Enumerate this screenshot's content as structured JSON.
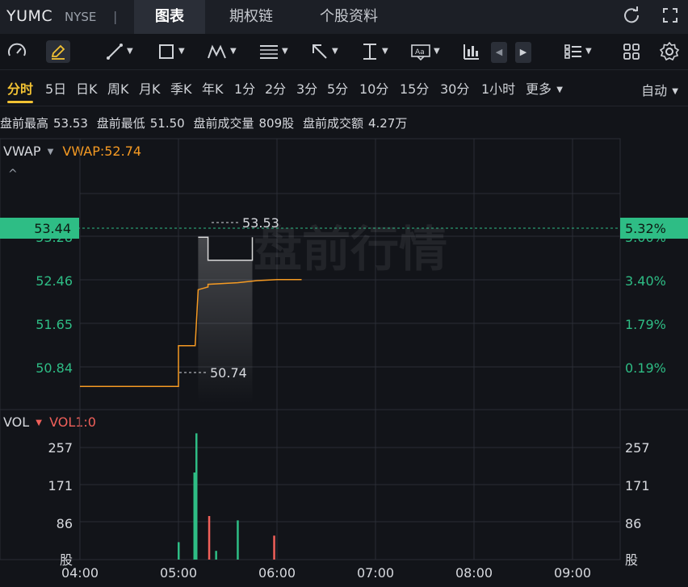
{
  "header": {
    "ticker": "YUMC",
    "exchange": "NYSE",
    "separator": "|",
    "tabs": [
      {
        "label": "图表",
        "active": true
      },
      {
        "label": "期权链",
        "active": false
      },
      {
        "label": "个股资料",
        "active": false
      }
    ]
  },
  "toolbar": {
    "icons": [
      "speedometer-icon",
      "pencil-icon",
      "line-tool-icon",
      "rectangle-tool-icon",
      "pattern-tool-icon",
      "fib-tool-icon",
      "arrow-tool-icon",
      "measure-tool-icon",
      "text-tool-icon",
      "indicator-icon",
      "prev-icon",
      "next-icon",
      "layout-list-icon",
      "grid-icon",
      "settings-icon"
    ]
  },
  "periods": {
    "items": [
      "分时",
      "5日",
      "日K",
      "周K",
      "月K",
      "季K",
      "年K",
      "1分",
      "2分",
      "3分",
      "5分",
      "10分",
      "15分",
      "30分",
      "1小时",
      "更多"
    ],
    "active_index": 0,
    "auto_label": "自动"
  },
  "info": {
    "high_label": "盘前最高",
    "high_value": "53.53",
    "low_label": "盘前最低",
    "low_value": "51.50",
    "vol_label": "盘前成交量",
    "vol_value": "809股",
    "amt_label": "盘前成交额",
    "amt_value": "4.27万"
  },
  "price_panel": {
    "indicator_name": "VWAP",
    "indicator_value": "VWAP:52.74",
    "watermark": "盘前行情",
    "current_price_tag": "53.44",
    "current_pct_tag": "5.32%",
    "high_annotation": "53.53",
    "low_annotation": "50.74",
    "left_ticks": [
      "53.28",
      "52.46",
      "51.65",
      "50.84"
    ],
    "right_ticks": [
      "5.00%",
      "3.40%",
      "1.79%",
      "0.19%"
    ]
  },
  "volume_panel": {
    "indicator_name": "VOL",
    "indicator_value": "VOL1:0",
    "left_ticks": [
      "257",
      "171",
      "86",
      "股"
    ],
    "right_ticks": [
      "257",
      "171",
      "86",
      "股"
    ]
  },
  "chart_data": {
    "type": "line",
    "x_ticks": [
      "04:00",
      "05:00",
      "06:00",
      "07:00",
      "08:00",
      "09:00"
    ],
    "ylim": [
      50.35,
      54.35
    ],
    "series": [
      {
        "name": "price",
        "color": "#d9d9d9",
        "points": [
          [
            5.2,
            53.53
          ],
          [
            5.3,
            53.53
          ],
          [
            5.3,
            53.1
          ],
          [
            5.75,
            53.1
          ],
          [
            5.75,
            53.53
          ]
        ]
      },
      {
        "name": "VWAP",
        "color": "#f59a23",
        "points": [
          [
            4.0,
            50.74
          ],
          [
            5.0,
            50.74
          ],
          [
            5.0,
            51.5
          ],
          [
            5.17,
            51.5
          ],
          [
            5.2,
            52.55
          ],
          [
            5.3,
            52.6
          ],
          [
            5.3,
            52.65
          ],
          [
            5.6,
            52.68
          ],
          [
            5.8,
            52.72
          ],
          [
            6.0,
            52.74
          ],
          [
            6.25,
            52.74
          ]
        ]
      }
    ],
    "volume": {
      "ylim": [
        0,
        300
      ],
      "bars": [
        {
          "t": 5.0,
          "v": 40,
          "color": "#2ebd85"
        },
        {
          "t": 5.16,
          "v": 200,
          "color": "#2ebd85"
        },
        {
          "t": 5.18,
          "v": 290,
          "color": "#2ebd85"
        },
        {
          "t": 5.31,
          "v": 100,
          "color": "#f0605a"
        },
        {
          "t": 5.38,
          "v": 20,
          "color": "#2ebd85"
        },
        {
          "t": 5.6,
          "v": 90,
          "color": "#2ebd85"
        },
        {
          "t": 5.97,
          "v": 55,
          "color": "#f0605a"
        }
      ]
    },
    "colors": {
      "grid": "#2a2d35",
      "up": "#2ebd85",
      "down": "#f0605a",
      "tag_bg": "#2ebd85"
    }
  }
}
